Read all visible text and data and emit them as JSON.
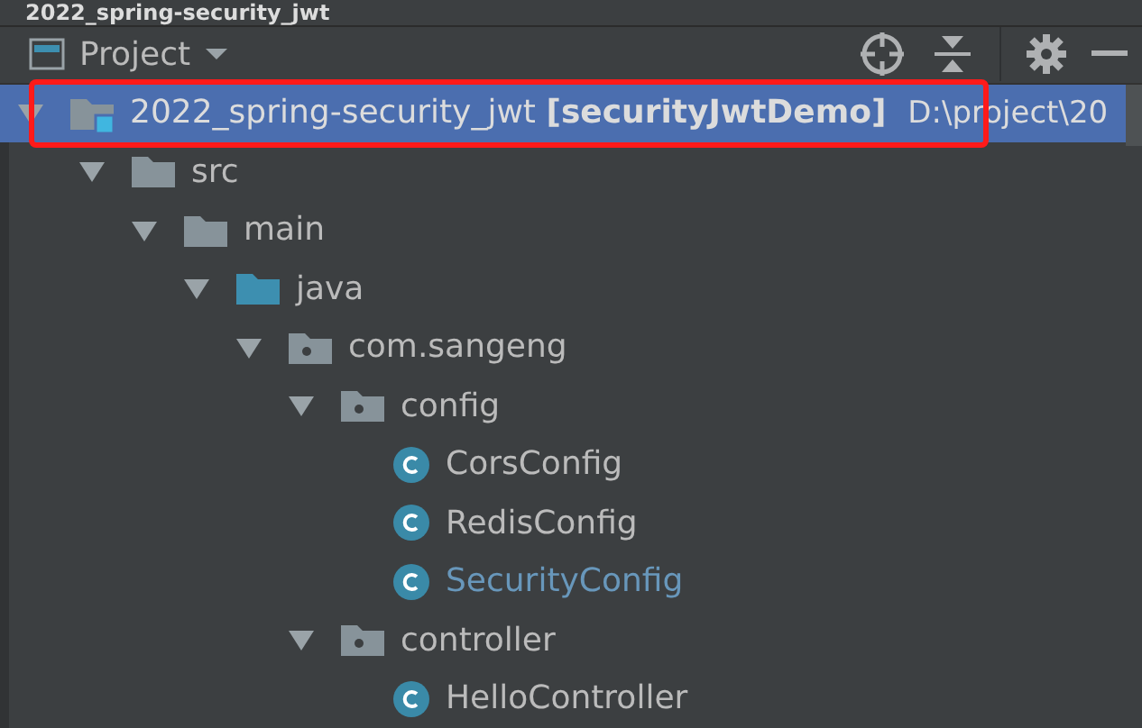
{
  "window": {
    "title": "2022_spring-security_jwt"
  },
  "toolbar": {
    "view": "Project"
  },
  "tree": [
    {
      "kind": "module",
      "label": "2022_spring-security_jwt **[securityJwtDemo]**",
      "path": "D:\\project\\20",
      "selected": true,
      "highlight_frame": true,
      "modified": false,
      "expanded": true,
      "children": [
        {
          "kind": "folder",
          "label": "src",
          "selected": false,
          "modified": false,
          "expanded": true,
          "children": [
            {
              "kind": "folder",
              "label": "main",
              "selected": false,
              "modified": false,
              "expanded": true,
              "children": [
                {
                  "kind": "source",
                  "label": "java",
                  "selected": false,
                  "modified": false,
                  "expanded": true,
                  "children": [
                    {
                      "kind": "package",
                      "label": "com.sangeng",
                      "selected": false,
                      "modified": false,
                      "expanded": true,
                      "children": [
                        {
                          "kind": "package",
                          "label": "config",
                          "selected": false,
                          "modified": false,
                          "expanded": true,
                          "children": [
                            {
                              "kind": "class",
                              "label": "CorsConfig",
                              "selected": false,
                              "modified": false
                            },
                            {
                              "kind": "class",
                              "label": "RedisConfig",
                              "selected": false,
                              "modified": false
                            },
                            {
                              "kind": "class",
                              "label": "SecurityConfig",
                              "selected": false,
                              "modified": true
                            }
                          ]
                        },
                        {
                          "kind": "package",
                          "label": "controller",
                          "selected": false,
                          "modified": false,
                          "expanded": true,
                          "children": [
                            {
                              "kind": "class",
                              "label": "HelloController",
                              "selected": false,
                              "modified": false
                            }
                          ]
                        }
                      ]
                    }
                  ]
                }
              ]
            }
          ]
        }
      ]
    }
  ]
}
